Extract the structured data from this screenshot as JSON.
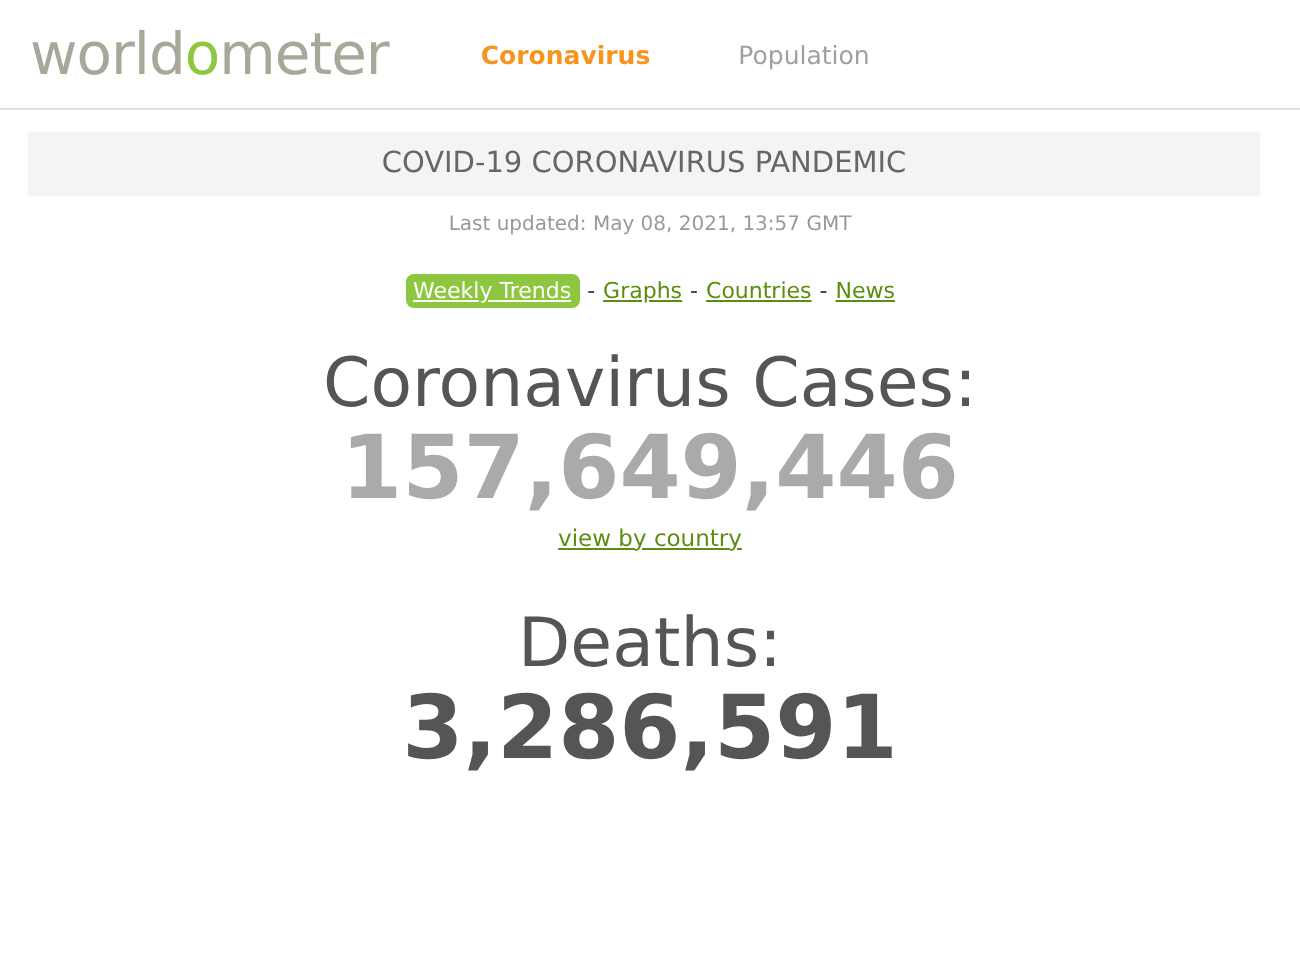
{
  "logo": {
    "start": "world",
    "accent": "o",
    "end": "meter"
  },
  "nav": [
    {
      "label": "Coronavirus",
      "selected": true
    },
    {
      "label": "Population",
      "selected": false
    }
  ],
  "banner": {
    "title": "COVID-19 CORONAVIRUS PANDEMIC",
    "updated": "Last updated: May 08, 2021, 13:57 GMT"
  },
  "links": [
    {
      "label": "Weekly Trends",
      "selected": true
    },
    {
      "label": "Graphs",
      "selected": false
    },
    {
      "label": "Countries",
      "selected": false
    },
    {
      "label": "News",
      "selected": false
    }
  ],
  "separator": "-",
  "stats": [
    {
      "kind": "muted",
      "title": "Coronavirus Cases:",
      "value": "157,649,446",
      "link": "view by country"
    },
    {
      "kind": "dark",
      "title": "Deaths:",
      "value": "3,286,591"
    }
  ]
}
